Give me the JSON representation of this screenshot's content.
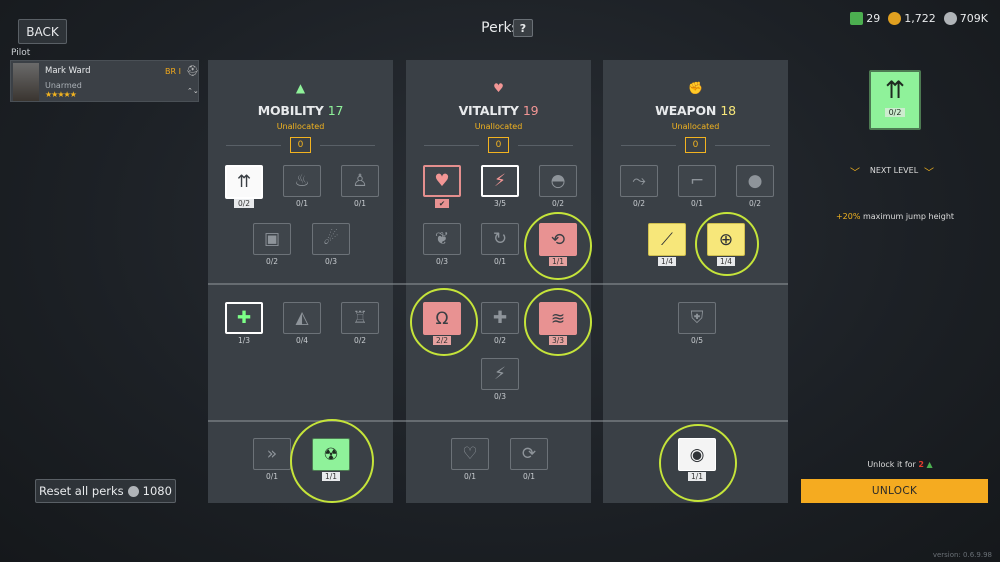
{
  "header": {
    "back_label": "BACK",
    "title": "Perks",
    "help_label": "?"
  },
  "currencies": [
    {
      "name": "tokens",
      "value": "29",
      "color": "#4caf50"
    },
    {
      "name": "gold",
      "value": "1,722",
      "color": "#e0a020"
    },
    {
      "name": "silver",
      "value": "709K",
      "color": "#b0b4b8"
    }
  ],
  "pilot": {
    "section_label": "Pilot",
    "name": "Mark Ward",
    "weapon": "Unarmed",
    "stars": "★★★★★",
    "rank": "BR I"
  },
  "columns": [
    {
      "title": "MOBILITY",
      "points": "17",
      "subtitle": "Unallocated",
      "unallocated": "0",
      "accent": "#8ff29a",
      "perks": [
        {
          "icon": "jump-height-icon",
          "count": "0/2",
          "state": "selw"
        },
        {
          "icon": "flame-icon",
          "count": "0/1",
          "state": "lock"
        },
        {
          "icon": "sit-icon",
          "count": "0/1",
          "state": "lock"
        },
        {
          "icon": "backpack-icon",
          "count": "0/2",
          "state": "lock"
        },
        {
          "icon": "throw-icon",
          "count": "0/3",
          "state": "lock"
        },
        {
          "icon": "medkit-speed-icon",
          "count": "1/3",
          "state": "greenactive"
        },
        {
          "icon": "climb-icon",
          "count": "0/4",
          "state": "lock"
        },
        {
          "icon": "sprint-icon",
          "count": "0/2",
          "state": "lock"
        },
        {
          "icon": "dash-icon",
          "count": "0/1",
          "state": "lock"
        },
        {
          "icon": "radiation-head-icon",
          "count": "1/1",
          "state": "green"
        }
      ]
    },
    {
      "title": "VITALITY",
      "points": "19",
      "subtitle": "Unallocated",
      "unallocated": "0",
      "accent": "#f29695",
      "perks": [
        {
          "icon": "heart-check-icon",
          "count": "",
          "state": "red"
        },
        {
          "icon": "shock-icon",
          "count": "3/5",
          "state": "redact"
        },
        {
          "icon": "helmet-icon",
          "count": "0/2",
          "state": "lock"
        },
        {
          "icon": "lungs-icon",
          "count": "0/3",
          "state": "lock"
        },
        {
          "icon": "recharge-icon",
          "count": "0/1",
          "state": "lock"
        },
        {
          "icon": "cycle-icon",
          "count": "1/1",
          "state": "redfill"
        },
        {
          "icon": "magnet-icon",
          "count": "2/2",
          "state": "redfill"
        },
        {
          "icon": "health-up-icon",
          "count": "0/2",
          "state": "lock"
        },
        {
          "icon": "wings-icon",
          "count": "3/3",
          "state": "redfill"
        },
        {
          "icon": "energy-up-icon",
          "count": "0/3",
          "state": "lock"
        },
        {
          "icon": "heart-up-icon",
          "count": "0/1",
          "state": "lock"
        },
        {
          "icon": "regen-icon",
          "count": "0/1",
          "state": "lock"
        }
      ]
    },
    {
      "title": "WEAPON",
      "points": "18",
      "subtitle": "Unallocated",
      "unallocated": "0",
      "accent": "#f7e77a",
      "perks": [
        {
          "icon": "slide-icon",
          "count": "0/2",
          "state": "lock"
        },
        {
          "icon": "pistol-icon",
          "count": "0/1",
          "state": "lock"
        },
        {
          "icon": "grenade-icon",
          "count": "0/2",
          "state": "lock"
        },
        {
          "icon": "knife-icon",
          "count": "1/4",
          "state": "yellow"
        },
        {
          "icon": "target-icon",
          "count": "1/4",
          "state": "yellow"
        },
        {
          "icon": "shield-icon",
          "count": "0/5",
          "state": "lock"
        },
        {
          "icon": "eye-icon",
          "count": "1/1",
          "state": "white"
        }
      ]
    }
  ],
  "detail": {
    "preview_count": "0/2",
    "next_level_label": "NEXT LEVEL",
    "bonus_value": "+20%",
    "bonus_text": " maximum jump height",
    "unlock_for_label": "Unlock it for ",
    "unlock_cost": "2",
    "unlock_label": "UNLOCK"
  },
  "footer": {
    "reset_label": "Reset all perks",
    "reset_cost": "1080",
    "version": "version: 0.6.9.98"
  }
}
